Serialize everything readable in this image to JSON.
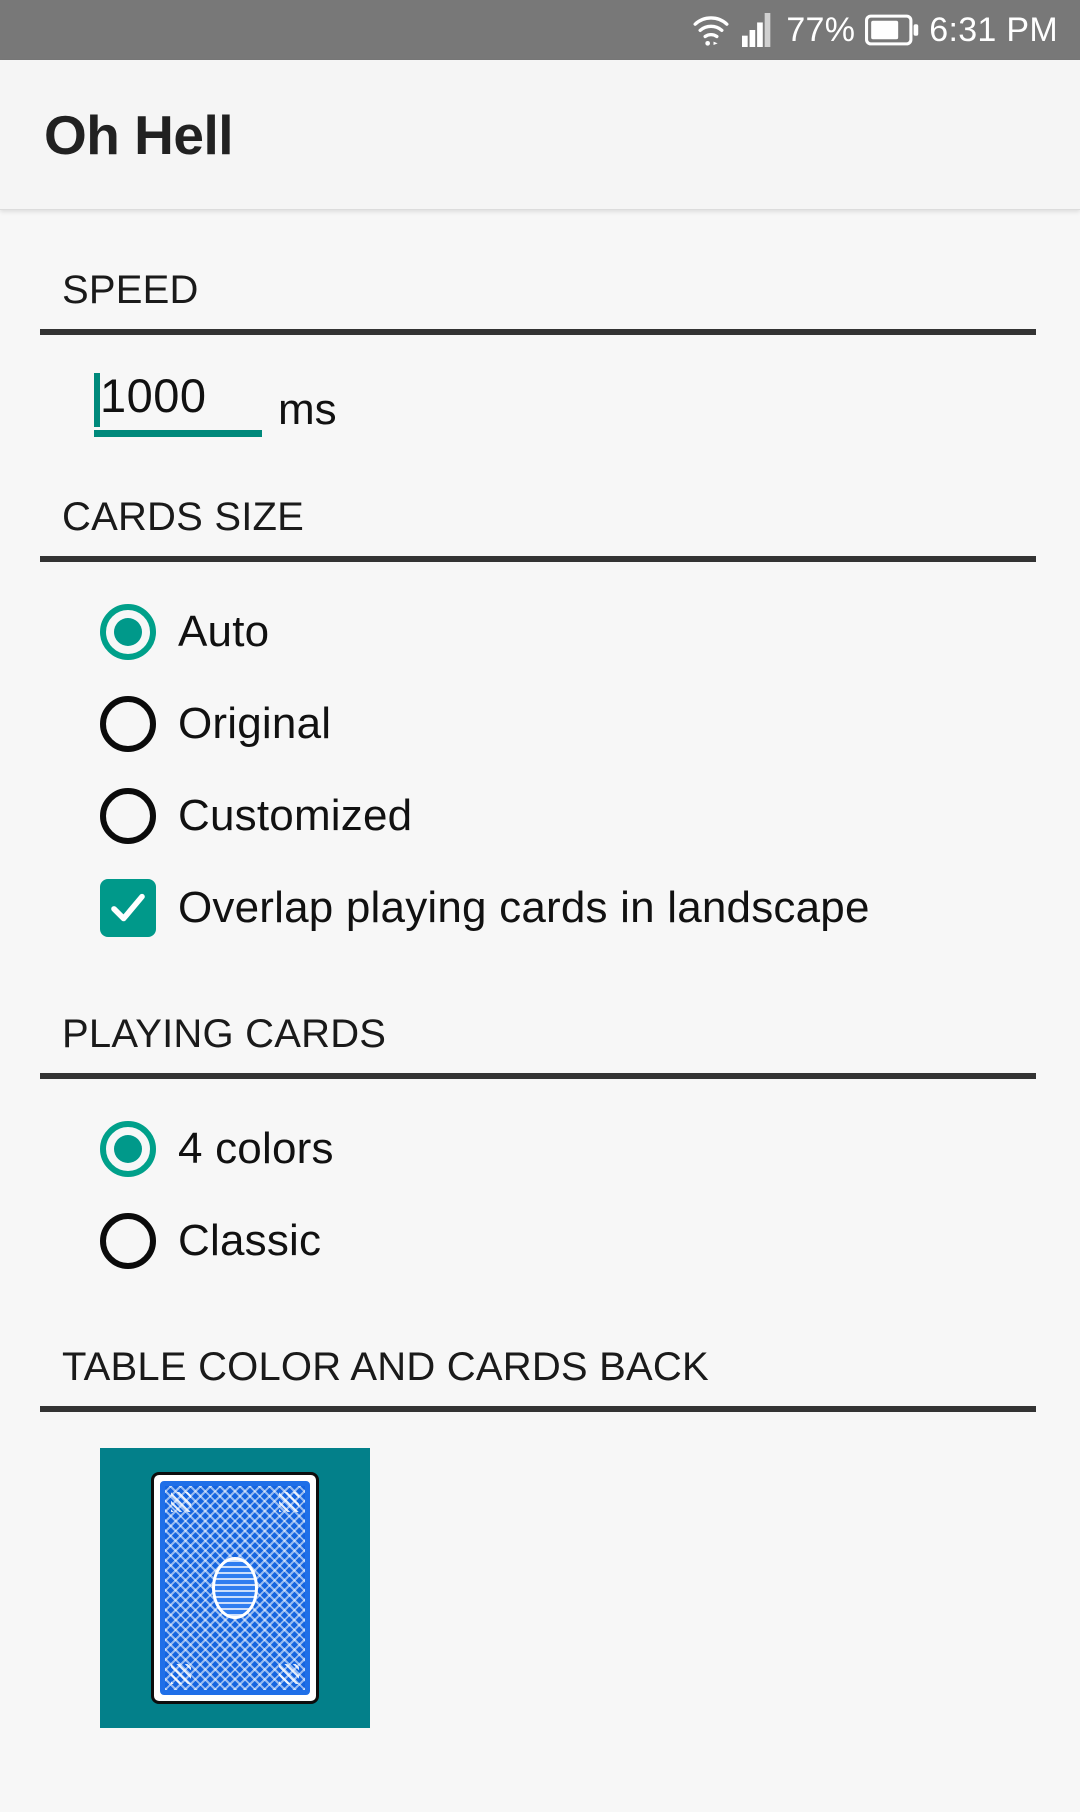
{
  "status_bar": {
    "wifi_icon": "wifi-icon",
    "signal_icon": "cell-signal-icon",
    "battery_percent": "77%",
    "battery_icon": "battery-icon",
    "time": "6:31 PM"
  },
  "app_bar": {
    "title": "Oh Hell"
  },
  "theme": {
    "accent": "#00998a",
    "accent_underline": "#00897b",
    "table_color": "#03808a",
    "card_back_color": "#1565e0",
    "status_bar_bg": "#787878",
    "app_bar_bg": "#f5f5f5",
    "page_bg": "#f7f7f7",
    "rule_color": "#333333"
  },
  "sections": {
    "speed": {
      "header": "SPEED",
      "value": "1000",
      "placeholder": "1000",
      "unit": "ms"
    },
    "cards_size": {
      "header": "CARDS SIZE",
      "options": [
        {
          "label": "Auto",
          "selected": true
        },
        {
          "label": "Original",
          "selected": false
        },
        {
          "label": "Customized",
          "selected": false
        }
      ],
      "checkbox": {
        "label": "Overlap playing cards in landscape",
        "checked": true
      }
    },
    "playing_cards": {
      "header": "PLAYING CARDS",
      "options": [
        {
          "label": "4 colors",
          "selected": true
        },
        {
          "label": "Classic",
          "selected": false
        }
      ]
    },
    "table_color": {
      "header": "TABLE COLOR AND CARDS BACK",
      "swatch_name": "table-color-and-card-back-preview"
    }
  }
}
